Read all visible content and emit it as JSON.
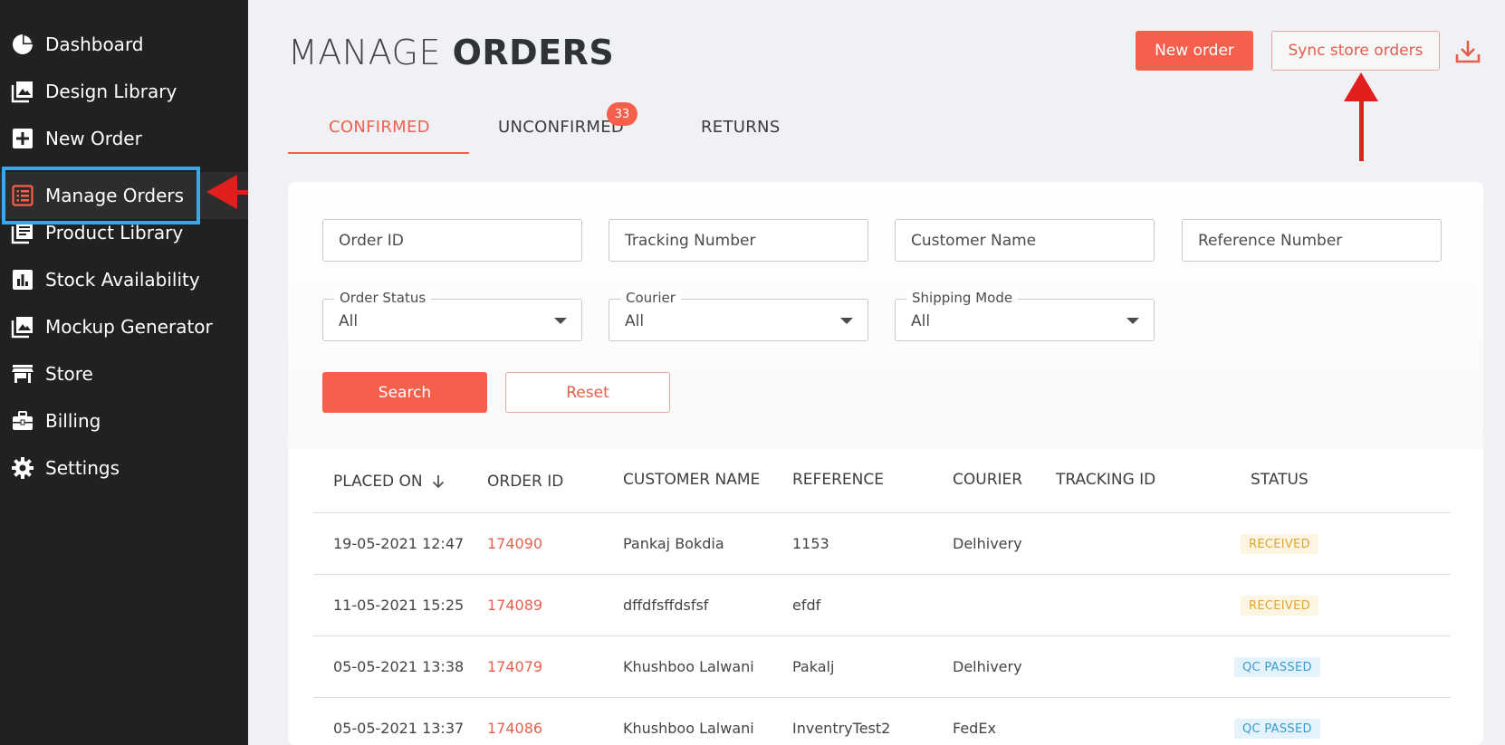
{
  "sidebar": {
    "items": [
      {
        "label": "Dashboard",
        "icon": "pie-chart-icon"
      },
      {
        "label": "Design Library",
        "icon": "image-library-icon"
      },
      {
        "label": "New Order",
        "icon": "plus-square-icon"
      },
      {
        "label": "Manage Orders",
        "icon": "list-icon",
        "active": true
      },
      {
        "label": "Product Library",
        "icon": "book-icon"
      },
      {
        "label": "Stock Availability",
        "icon": "bar-chart-icon"
      },
      {
        "label": "Mockup Generator",
        "icon": "image-icon"
      },
      {
        "label": "Store",
        "icon": "store-icon"
      },
      {
        "label": "Billing",
        "icon": "briefcase-icon"
      },
      {
        "label": "Settings",
        "icon": "gear-icon"
      }
    ]
  },
  "header": {
    "title_light": "MANAGE",
    "title_bold": "ORDERS",
    "new_order_label": "New order",
    "sync_label": "Sync store orders"
  },
  "tabs": [
    {
      "label": "CONFIRMED",
      "active": true
    },
    {
      "label": "UNCONFIRMED",
      "badge": "33"
    },
    {
      "label": "RETURNS"
    }
  ],
  "filters": {
    "order_id_placeholder": "Order ID",
    "tracking_placeholder": "Tracking Number",
    "customer_placeholder": "Customer Name",
    "reference_placeholder": "Reference Number",
    "order_status": {
      "label": "Order Status",
      "value": "All"
    },
    "courier": {
      "label": "Courier",
      "value": "All"
    },
    "shipping_mode": {
      "label": "Shipping Mode",
      "value": "All"
    },
    "search_label": "Search",
    "reset_label": "Reset"
  },
  "table": {
    "headers": {
      "placed_on": "PLACED ON",
      "order_id": "ORDER ID",
      "customer_name": "CUSTOMER NAME",
      "reference": "REFERENCE",
      "courier": "COURIER",
      "tracking_id": "TRACKING ID",
      "status": "STATUS"
    },
    "rows": [
      {
        "placed_on": "19-05-2021 12:47",
        "order_id": "174090",
        "customer": "Pankaj Bokdia",
        "reference": "1153",
        "courier": "Delhivery",
        "tracking": "",
        "status": "RECEIVED"
      },
      {
        "placed_on": "11-05-2021 15:25",
        "order_id": "174089",
        "customer": "dffdfsffdsfsf",
        "reference": "efdf",
        "courier": "",
        "tracking": "",
        "status": "RECEIVED"
      },
      {
        "placed_on": "05-05-2021 13:38",
        "order_id": "174079",
        "customer": "Khushboo Lalwani",
        "reference": "Pakalj",
        "courier": "Delhivery",
        "tracking": "",
        "status": "QC PASSED"
      },
      {
        "placed_on": "05-05-2021 13:37",
        "order_id": "174086",
        "customer": "Khushboo Lalwani",
        "reference": "InventryTest2",
        "courier": "FedEx",
        "tracking": "",
        "status": "QC PASSED"
      }
    ]
  },
  "colors": {
    "accent": "#f4604c",
    "sidebar_bg": "#212121",
    "highlight_box": "#3aa7e6",
    "annotation_arrow": "#e21f1f",
    "received": "#e2a531",
    "qc_passed": "#3a9bd1"
  }
}
